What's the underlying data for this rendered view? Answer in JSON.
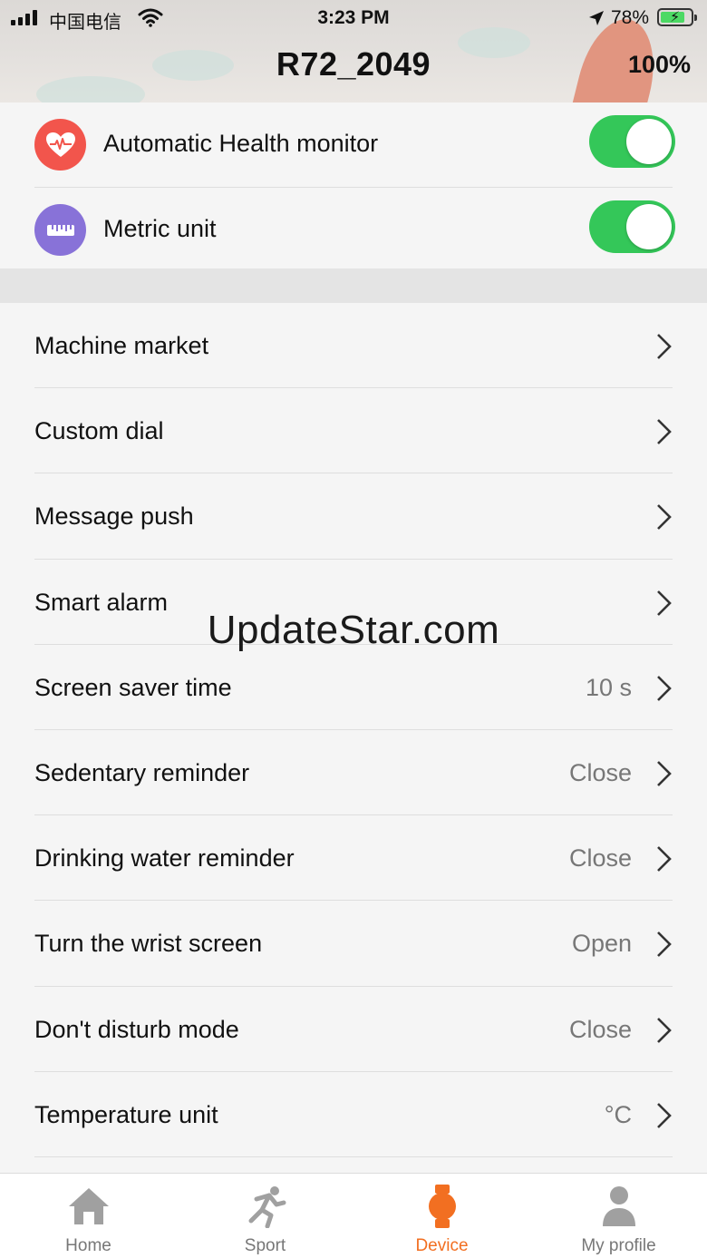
{
  "status_bar": {
    "carrier": "中国电信",
    "time": "3:23 PM",
    "battery_percent": "78%"
  },
  "header": {
    "title": "R72_2049",
    "device_battery": "100%"
  },
  "toggles": [
    {
      "label": "Automatic Health monitor",
      "icon": "heart-rate-icon",
      "icon_color": "#f2554c",
      "on": true
    },
    {
      "label": "Metric unit",
      "icon": "ruler-icon",
      "icon_color": "#8872d8",
      "on": true
    }
  ],
  "settings": [
    {
      "label": "Machine market",
      "value": ""
    },
    {
      "label": "Custom dial",
      "value": ""
    },
    {
      "label": "Message push",
      "value": ""
    },
    {
      "label": "Smart alarm",
      "value": ""
    },
    {
      "label": "Screen saver time",
      "value": "10 s"
    },
    {
      "label": "Sedentary reminder",
      "value": "Close"
    },
    {
      "label": "Drinking water reminder",
      "value": "Close"
    },
    {
      "label": "Turn the wrist screen",
      "value": "Open"
    },
    {
      "label": "Don't disturb mode",
      "value": "Close"
    },
    {
      "label": "Temperature unit",
      "value": "°C"
    }
  ],
  "watermark": "UpdateStar.com",
  "tabs": [
    {
      "label": "Home",
      "icon": "home-icon",
      "active": false
    },
    {
      "label": "Sport",
      "icon": "running-icon",
      "active": false
    },
    {
      "label": "Device",
      "icon": "watch-icon",
      "active": true
    },
    {
      "label": "My profile",
      "icon": "person-icon",
      "active": false
    }
  ],
  "colors": {
    "accent": "#f26f21",
    "toggle_on": "#34c759",
    "inactive_tab": "#9a9a9a"
  }
}
